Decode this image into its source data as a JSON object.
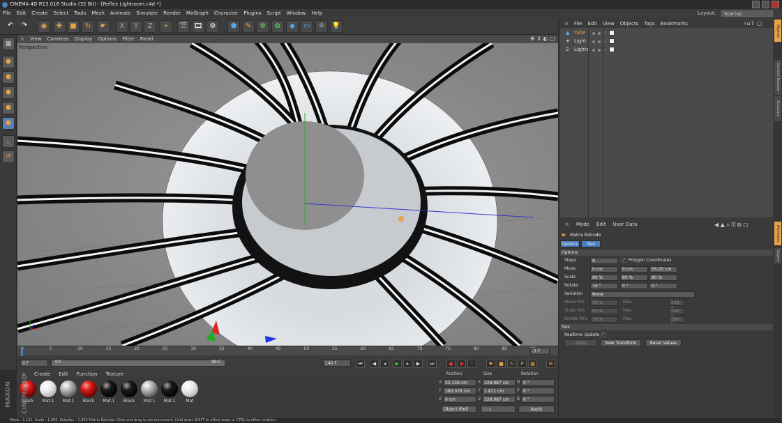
{
  "window": {
    "title": "CINEMA 4D R13.016 Studio (32 Bit) - [Reflex Lightroom.c4d *]"
  },
  "menubar": [
    "File",
    "Edit",
    "Create",
    "Select",
    "Tools",
    "Mesh",
    "Animate",
    "Simulate",
    "Render",
    "MoGraph",
    "Character",
    "Plugins",
    "Script",
    "Window",
    "Help"
  ],
  "layout": {
    "label": "Layout:",
    "value": "Startup"
  },
  "viewport": {
    "menu": [
      "View",
      "Cameras",
      "Display",
      "Options",
      "Filter",
      "Panel"
    ],
    "label": "Perspective"
  },
  "timeline": {
    "ticks": [
      "0",
      "5",
      "10",
      "15",
      "20",
      "25",
      "30",
      "35",
      "40",
      "45",
      "50",
      "55",
      "60",
      "65",
      "70",
      "75",
      "80",
      "85",
      "90"
    ],
    "frame_end_field": "-7 F"
  },
  "transport": {
    "start": "0 F",
    "current": "0 F",
    "slider_label": "90 F",
    "end": "140 F"
  },
  "materials": {
    "menu": [
      "Create",
      "Edit",
      "Function",
      "Texture"
    ],
    "items": [
      {
        "label": "Black",
        "color": "red"
      },
      {
        "label": "Mat.1",
        "color": "white"
      },
      {
        "label": "Mat.1",
        "color": "grey"
      },
      {
        "label": "Black",
        "color": "red"
      },
      {
        "label": "Mat.1",
        "color": "black"
      },
      {
        "label": "Black",
        "color": "black"
      },
      {
        "label": "Mat.1",
        "color": "grey"
      },
      {
        "label": "Mat.1",
        "color": "black"
      },
      {
        "label": "Mat",
        "color": "white"
      }
    ]
  },
  "branding": "MAXON CINEMA 4D",
  "coordinates": {
    "headers": [
      "Position",
      "Size",
      "Rotation"
    ],
    "rows": [
      {
        "axis": "X",
        "pos": "33.159 cm",
        "size_axis": "X",
        "size": "328.987 cm",
        "rot_axis": "H",
        "rot": "0 °"
      },
      {
        "axis": "Y",
        "pos": "380.078 cm",
        "size_axis": "Y",
        "size": "1.811 cm",
        "rot_axis": "P",
        "rot": "0 °"
      },
      {
        "axis": "Z",
        "pos": "0 cm",
        "size_axis": "Z",
        "size": "328.987 cm",
        "rot_axis": "B",
        "rot": "0 °"
      }
    ],
    "mode": "Object (Rel)",
    "size_mode": "Size",
    "apply": "Apply"
  },
  "status": "Move : 1.101, Scale : 1.000, Rotation : 1.000   Matrix Extrude: Click and drag to set movement. Hold down SHIFT to affect scale or CTRL to affect rotation.",
  "objects": {
    "menu": [
      "File",
      "Edit",
      "View",
      "Objects",
      "Tags",
      "Bookmarks"
    ],
    "items": [
      {
        "name": "Tube",
        "selected": true
      },
      {
        "name": "Light",
        "selected": false
      },
      {
        "name": "Lights",
        "selected": false
      }
    ]
  },
  "right_tabs": [
    "Objects",
    "Content Browser",
    "Structure"
  ],
  "attr_tabs_side": [
    "Attributes",
    "Layers"
  ],
  "attributes": {
    "menu": [
      "Mode",
      "Edit",
      "User Data"
    ],
    "tool_name": "Matrix Extrude",
    "tabs": [
      "Options",
      "Tool"
    ],
    "options_header": "Options",
    "steps_label": "Steps",
    "steps_value": "8",
    "polygon_coords_label": "Polygon Coordinates",
    "move_label": "Move",
    "move_values": [
      "0 cm",
      "0 cm",
      "55.05 cm"
    ],
    "scale_label": "Scale",
    "scale_values": [
      "80 %",
      "80 %",
      "80 %"
    ],
    "rotate_label": "Rotate",
    "rotate_values": [
      "10 °",
      "0 °",
      "0 °"
    ],
    "variation_label": "Variation",
    "variation_value": "None",
    "move_min_label": "Move Min.",
    "move_min": "50 %",
    "move_max_label": "Max.",
    "move_max": "100 %",
    "scale_min_label": "Scale Min.",
    "scale_min": "50 %",
    "scale_max_label": "Max.",
    "scale_max": "100 %",
    "rotate_min_label": "Rotate Min.",
    "rotate_min": "50 %",
    "rotate_max_label": "Max.",
    "rotate_max": "100 %",
    "tool_header": "Tool",
    "realtime_label": "Realtime Update",
    "apply_btn": "Apply",
    "new_transform_btn": "New Transform",
    "reset_btn": "Reset Values"
  },
  "colors": {
    "accent": "#e8a24a",
    "selection": "#4a7fc0",
    "x_axis": "#d22",
    "y_axis": "#2a2",
    "z_axis": "#23d"
  }
}
